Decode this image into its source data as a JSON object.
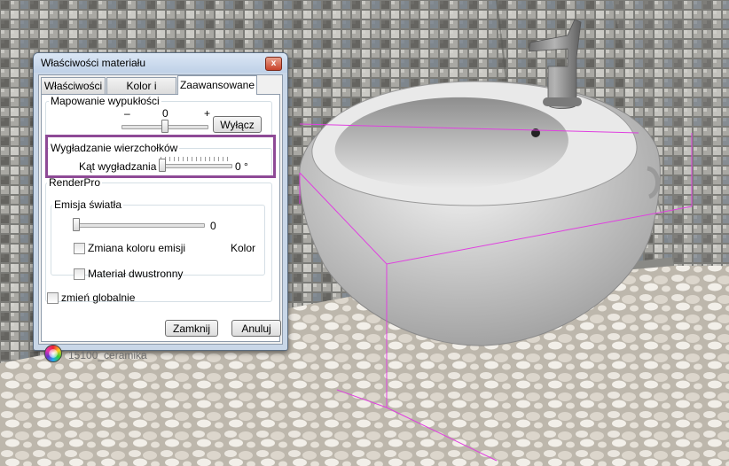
{
  "dialog": {
    "title": "Właściwości materiału",
    "close_glyph": "x",
    "tabs": [
      {
        "label": "Właściwości",
        "active": false
      },
      {
        "label": "Kolor i tekstura",
        "active": false
      },
      {
        "label": "Zaawansowane",
        "active": true
      }
    ],
    "bump": {
      "group_label": "Mapowanie wypukłości",
      "minus": "–",
      "plus": "+",
      "value": "0",
      "off_button": "Wyłącz"
    },
    "smoothing": {
      "group_label": "Wygładzanie wierzchołków",
      "angle_label": "Kąt wygładzania",
      "angle_value": "0 °"
    },
    "renderpro": {
      "group_label": "RenderPro",
      "emission_label": "Emisja światła",
      "emission_value": "0",
      "change_emission_color_label": "Zmiana koloru emisji",
      "change_emission_color_checked": false,
      "color_label": "Kolor",
      "double_sided_label": "Materiał dwustronny",
      "double_sided_checked": false
    },
    "change_globally_label": "zmień globalnie",
    "change_globally_checked": false,
    "material_name": "15100_ceramika",
    "close_button": "Zamknij",
    "cancel_button": "Anuluj"
  },
  "colors": {
    "highlight": "#8e4a96",
    "selection_box": "#e040e0",
    "bidet": "#d8d8d8",
    "faucet": "#8a8a8a"
  },
  "scene": {
    "object": "wall-hung bidet",
    "wall": "glass mosaic tiles",
    "floor": "pebble stones"
  }
}
